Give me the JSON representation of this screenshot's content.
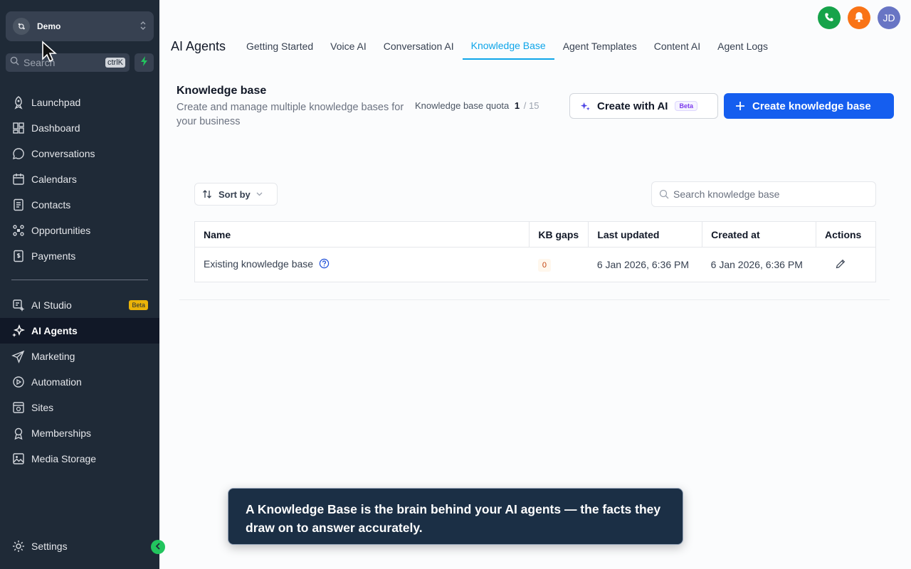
{
  "sidebar": {
    "account_name": "Demo",
    "search_placeholder": "Search",
    "search_shortcut": "ctrlK",
    "items_top": [
      {
        "label": "Launchpad",
        "icon": "rocket-icon"
      },
      {
        "label": "Dashboard",
        "icon": "grid-icon"
      },
      {
        "label": "Conversations",
        "icon": "chat-icon"
      },
      {
        "label": "Calendars",
        "icon": "calendar-icon"
      },
      {
        "label": "Contacts",
        "icon": "contacts-icon"
      },
      {
        "label": "Opportunities",
        "icon": "opportunities-icon"
      },
      {
        "label": "Payments",
        "icon": "payments-icon"
      }
    ],
    "items_bottom": [
      {
        "label": "AI Studio",
        "icon": "ai-studio-icon",
        "badge": "Beta"
      },
      {
        "label": "AI Agents",
        "icon": "sparkles-icon",
        "active": true
      },
      {
        "label": "Marketing",
        "icon": "send-icon"
      },
      {
        "label": "Automation",
        "icon": "automation-icon"
      },
      {
        "label": "Sites",
        "icon": "sites-icon"
      },
      {
        "label": "Memberships",
        "icon": "memberships-icon"
      },
      {
        "label": "Media Storage",
        "icon": "image-icon"
      }
    ],
    "settings_label": "Settings"
  },
  "header": {
    "avatar_initials": "JD",
    "page_title": "AI Agents",
    "tabs": [
      {
        "label": "Getting Started"
      },
      {
        "label": "Voice AI"
      },
      {
        "label": "Conversation AI"
      },
      {
        "label": "Knowledge Base",
        "active": true
      },
      {
        "label": "Agent Templates"
      },
      {
        "label": "Content AI"
      },
      {
        "label": "Agent Logs"
      }
    ]
  },
  "kb": {
    "title": "Knowledge base",
    "subtitle": "Create and manage multiple knowledge bases for your business",
    "quota_label": "Knowledge base quota",
    "quota_used": "1",
    "quota_total": "/ 15",
    "create_ai_label": "Create with AI",
    "beta_label": "Beta",
    "create_label": "Create knowledge base",
    "sort_label": "Sort by",
    "search_placeholder": "Search knowledge base"
  },
  "table": {
    "columns": [
      "Name",
      "KB gaps",
      "Last updated",
      "Created at",
      "Actions"
    ],
    "rows": [
      {
        "name": "Existing knowledge base",
        "gaps": "0",
        "updated": "6 Jan 2026, 6:36 PM",
        "created": "6 Jan 2026, 6:36 PM"
      }
    ]
  },
  "tooltip": {
    "text": "A Knowledge Base is the brain behind your AI agents — the facts they draw on to answer accurately."
  },
  "colors": {
    "sidebar_bg": "#1f2a37",
    "accent": "#0ea5e9",
    "primary_button": "#155eef",
    "phone": "#16a34a",
    "bell": "#f97316",
    "avatar": "#6875c4"
  }
}
